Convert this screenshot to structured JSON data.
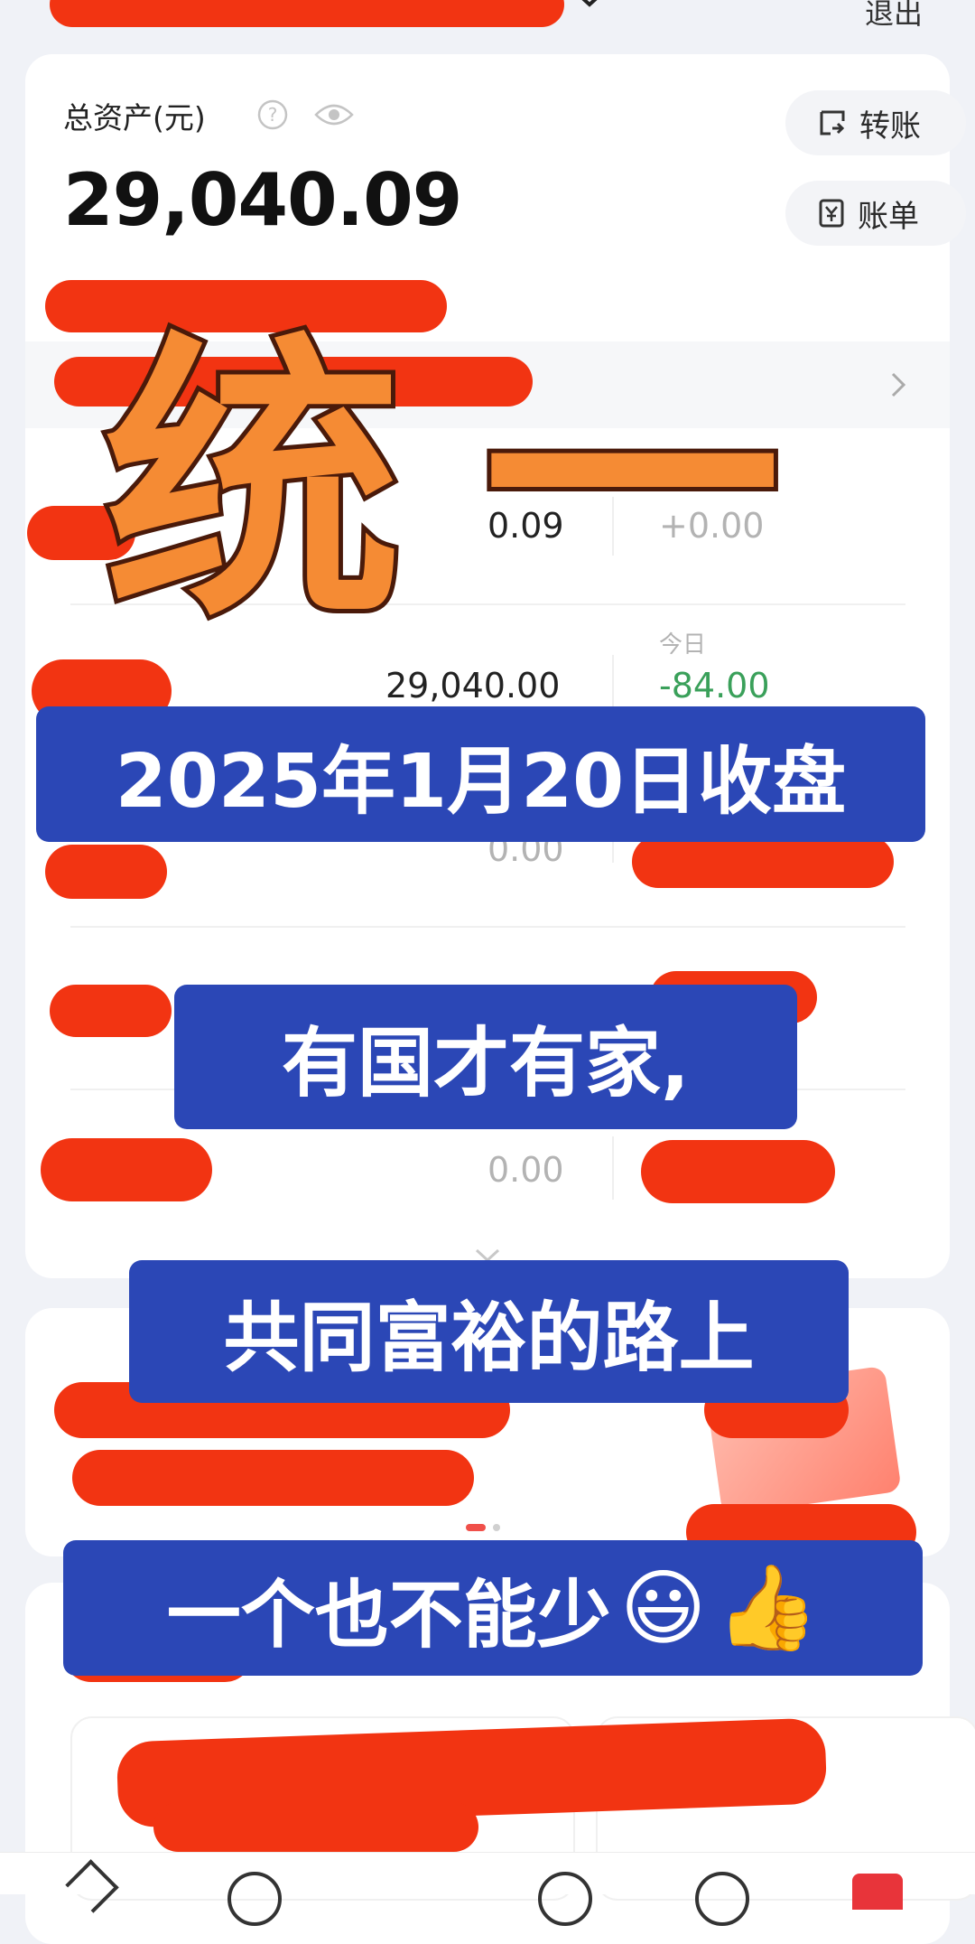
{
  "header": {
    "logout": "退出"
  },
  "assets": {
    "label": "总资产(元)",
    "total": "29,040.09",
    "transfer_label": "转账",
    "bill_label": "账单"
  },
  "rows": [
    {
      "amount": "0.09",
      "change": "+0.00",
      "change_label": ""
    },
    {
      "amount": "29,040.00",
      "change": "-84.00",
      "change_label": "今日"
    },
    {
      "amount": "0.00",
      "change": "",
      "change_label": ""
    },
    {
      "amount": "0.00",
      "change": "",
      "change_label": ""
    }
  ],
  "overlay": {
    "title": "统一",
    "date_banner": "2025年1月20日收盘",
    "line1": "有国才有家,",
    "line2": "共同富裕的路上",
    "line3": "一个也不能少",
    "emoji1": "😃",
    "emoji2": "👍"
  },
  "colors": {
    "accent_red": "#f23412",
    "banner_blue": "#2b47b6",
    "title_orange": "#f58b34",
    "negative_green": "#3aa05a"
  },
  "icons": [
    "help-icon",
    "eye-icon",
    "transfer-icon",
    "bill-icon",
    "chevron-right-icon",
    "chevron-down-icon",
    "dropdown-chevron-icon"
  ]
}
